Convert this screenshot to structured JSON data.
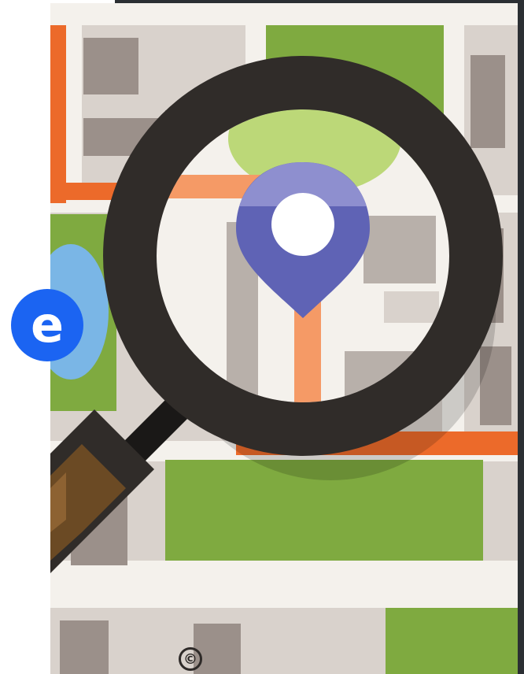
{
  "image": {
    "subject": "map-search-illustration",
    "badge": {
      "letter": "e",
      "color": "#1b64f2"
    },
    "corner_mark": "©",
    "palette": {
      "map_background": "#d9d2cc",
      "road_light": "#f4f1ec",
      "building_gray": "#9b908a",
      "park_green": "#7faa40",
      "park_light": "#bcd878",
      "road_orange": "#ec6a2a",
      "road_peach": "#f59a66",
      "water_blue": "#7ab6e6",
      "magnifier_dark": "#302c29",
      "handle_black": "#1a1817",
      "handle_brown": "#6b4a24",
      "pin_purple": "#5f63b5",
      "pin_hole": "#ffffff",
      "frame_dark": "#2b2f33"
    }
  }
}
